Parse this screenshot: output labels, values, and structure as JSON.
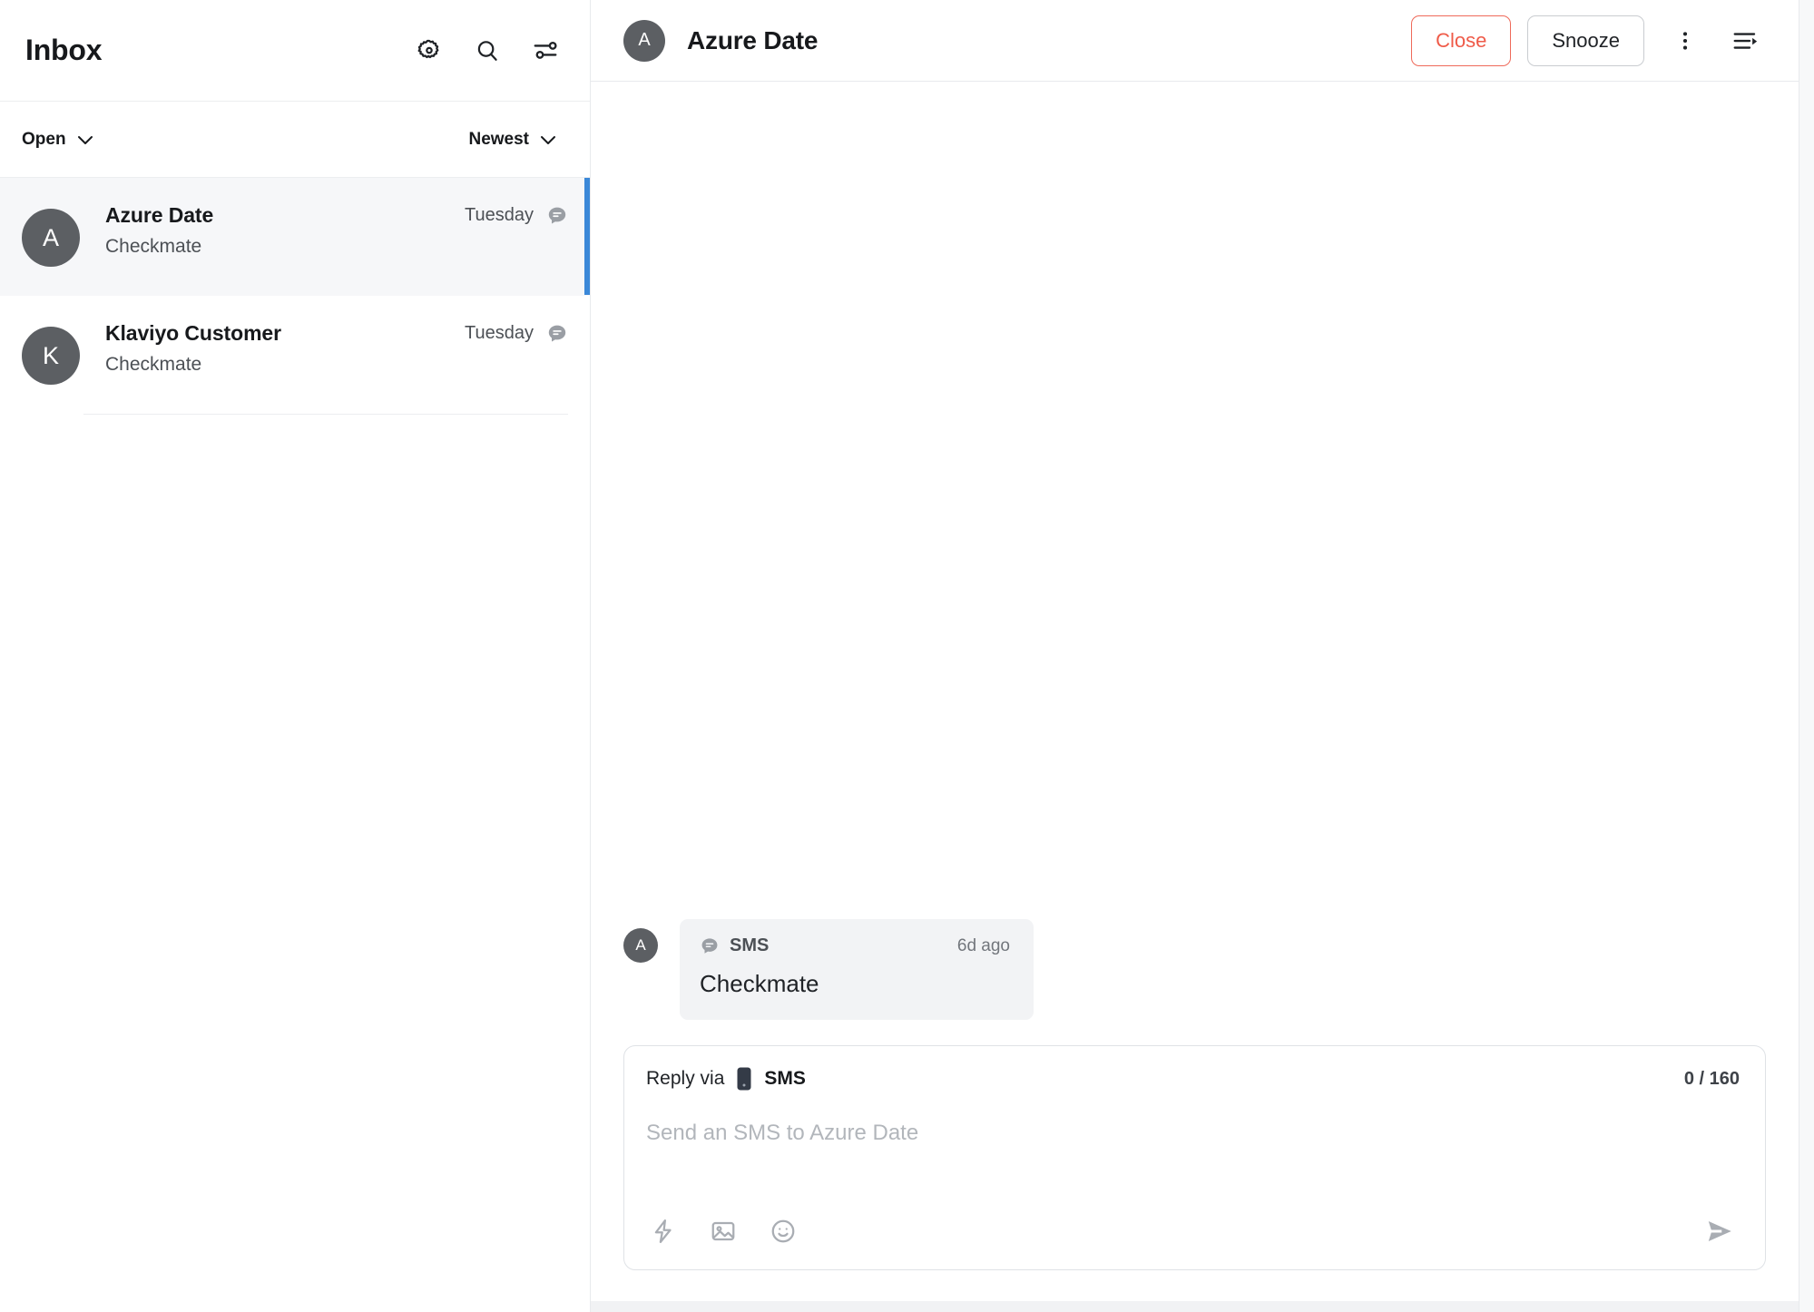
{
  "sidebar": {
    "title": "Inbox",
    "header_icons": [
      {
        "name": "gear-icon",
        "label": "Settings"
      },
      {
        "name": "search-icon",
        "label": "Search"
      },
      {
        "name": "filter-sliders-icon",
        "label": "Filters"
      }
    ],
    "filters": {
      "status": "Open",
      "sort": "Newest"
    },
    "conversations": [
      {
        "avatar_initial": "A",
        "name": "Azure Date",
        "preview": "Checkmate",
        "time": "Tuesday",
        "channel_icon": "sms-bubble-icon",
        "active": true
      },
      {
        "avatar_initial": "K",
        "name": "Klaviyo Customer",
        "preview": "Checkmate",
        "time": "Tuesday",
        "channel_icon": "sms-bubble-icon",
        "active": false
      }
    ]
  },
  "conversation": {
    "header": {
      "avatar_initial": "A",
      "title": "Azure Date",
      "close_label": "Close",
      "snooze_label": "Snooze",
      "more_icon": "more-vertical-icon",
      "details_icon": "details-panel-icon"
    },
    "messages": [
      {
        "avatar_initial": "A",
        "channel": "SMS",
        "channel_icon": "sms-bubble-icon",
        "time": "6d ago",
        "text": "Checkmate"
      }
    ]
  },
  "composer": {
    "reply_via_label": "Reply via",
    "channel": "SMS",
    "channel_icon": "mobile-phone-icon",
    "char_count": "0 / 160",
    "placeholder": "Send an SMS to Azure Date",
    "tools": [
      {
        "name": "macro-lightning-icon",
        "label": "Macros"
      },
      {
        "name": "image-attachment-icon",
        "label": "Image"
      },
      {
        "name": "emoji-icon",
        "label": "Emoji"
      }
    ],
    "send_icon": "send-paper-plane-icon"
  },
  "colors": {
    "accent_blue": "#3b88d8",
    "close_red": "#ef5b49",
    "avatar_gray": "#5c5f63",
    "bubble_bg": "#f2f3f5",
    "active_row_bg": "#f6f7f9"
  }
}
